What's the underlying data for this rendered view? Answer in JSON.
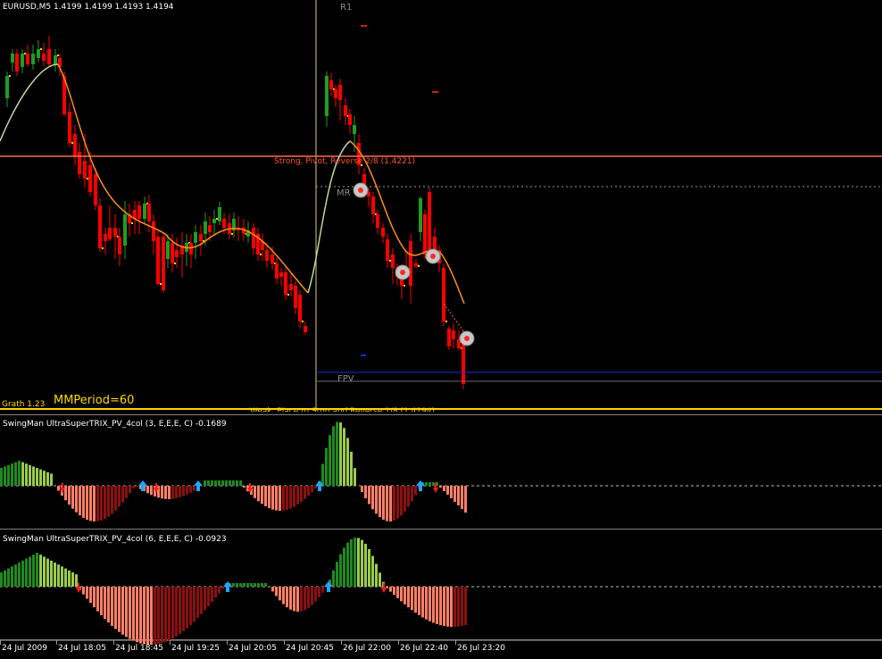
{
  "window": {
    "title": "EURUSD,M5  1.4199 1.4199 1.4193 1.4194"
  },
  "main_chart": {
    "symbol": "EURUSD",
    "timeframe": "M5",
    "open": 1.4199,
    "high": 1.4199,
    "low": 1.4193,
    "close": 1.4194,
    "labels": {
      "r1": "R1",
      "mr": "MR",
      "fpv": "FPV",
      "strong": "Strong, Pivot, Reverse  2/8  (1.4221)",
      "weak": "Weak, Place to Stop and Reverse  1/8  (1.4194)",
      "mmperiod": "MMPeriod=60",
      "grath": "Grath 1.23"
    },
    "colors": {
      "bull": "#1f9e1f",
      "bear": "#ff0000",
      "strong_line": "#ff6a4a",
      "weak_line": "#ffd400",
      "vline": "#e8e070",
      "fpv_line": "#0000cc",
      "ma_up": "#b9d8a0",
      "ma_down": "#ff8c1a"
    }
  },
  "indicator1": {
    "title": "SwingMan UltraSuperTRIX_PV_4col (3, E,E,E, C) -0.1689"
  },
  "indicator2": {
    "title": "SwingMan UltraSuperTRIX_PV_4col (6, E,E,E, C) -0.0923"
  },
  "time_axis": {
    "ticks": [
      "24 Jul 2009",
      "24 Jul 18:05",
      "24 Jul 18:45",
      "24 Jul 19:25",
      "24 Jul 20:05",
      "24 Jul 20:45",
      "26 Jul 22:00",
      "26 Jul 22:40",
      "26 Jul 23:20"
    ]
  }
}
